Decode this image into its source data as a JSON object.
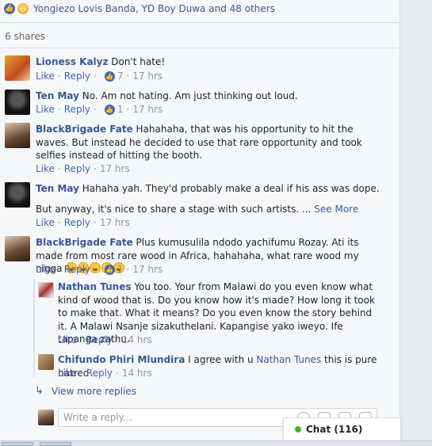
{
  "reactions": {
    "names": "Yongiezo Lovis Banda, YD Boy Duwa and 48 others"
  },
  "shares": "6 shares",
  "actions": {
    "like": "Like",
    "reply": "Reply",
    "dot": "·"
  },
  "comments": [
    {
      "author": "Lioness Kalyz",
      "text": "Don't hate!",
      "likes": "7",
      "time": "17 hrs"
    },
    {
      "author": "Ten May",
      "text": "No. Am not hating. Am just thinking out loud.",
      "likes": "1",
      "time": "17 hrs"
    },
    {
      "author": "BlackBrigade Fate",
      "text": "Hahahaha, that was his opportunity to hit the waves. But instead he decided to use that rare opportunity and took selfies instead of hitting the booth.",
      "likes": "",
      "time": "17 hrs"
    },
    {
      "author": "Ten May",
      "text": "Hahaha yah. They'd probably make a deal if his ass was dope.",
      "text2": "But anyway, it's nice to share a stage with such artists. ...",
      "see_more": "See More",
      "likes": "",
      "time": "17 hrs"
    },
    {
      "author": "BlackBrigade Fate",
      "text": "Plus kumusulila ndodo yachifumu Rozay. Ati its made from most rare wood in Africa, hahahaha, what rare wood my nigga",
      "likes": "1",
      "time": "17 hrs"
    }
  ],
  "replies": [
    {
      "author": "Nathan Tunes",
      "text": "You too. Your from Malawi do you even know what kind of wood that is. Do you know how it's made? How long it took to make that. What it means? Do you even know the story behind it. A Malawi Nsanje sizakuthelani. Kapangise yako iweyo. Ife tapanga zathu.",
      "time": "14 hrs"
    },
    {
      "author": "Chifundo Phiri Mlundira",
      "text_before": "I agree with u",
      "mention": "Nathan Tunes",
      "text_after": "this is pure hatred",
      "time": "14 hrs"
    }
  ],
  "view_more_replies": "View more replies",
  "reply_input": {
    "placeholder": "Write a reply..."
  },
  "chat": {
    "label": "Chat (116)"
  },
  "colors": {
    "link": "#385898",
    "meta": "#90949c",
    "like_blue": "#4267b2",
    "online_green": "#42b72a"
  },
  "icons": [
    "like-icon",
    "haha-icon",
    "reply-arrow-icon",
    "emoji-icon",
    "camera-icon",
    "gif-icon",
    "sticker-icon"
  ]
}
